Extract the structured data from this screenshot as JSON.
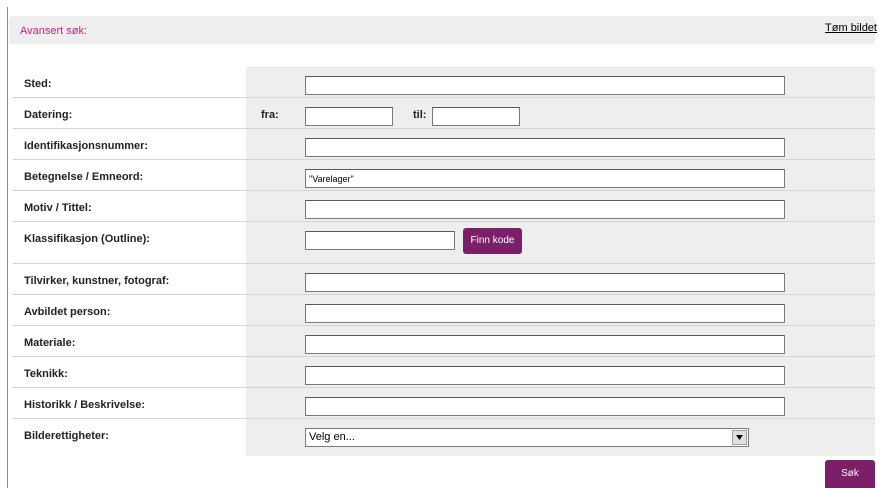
{
  "header": {
    "title": "Avansert søk:",
    "clear_link": "Tøm bildet"
  },
  "form": {
    "sted": {
      "label": "Sted:",
      "value": ""
    },
    "datering": {
      "label": "Datering:",
      "from_label": "fra:",
      "from_value": "",
      "to_label": "til:",
      "to_value": ""
    },
    "identifikasjonsnummer": {
      "label": "Identifikasjonsnummer:",
      "value": ""
    },
    "betegnelse": {
      "label": "Betegnelse / Emneord:",
      "value": "\"Varelager\""
    },
    "motiv": {
      "label": "Motiv / Tittel:",
      "value": ""
    },
    "klassifikasjon": {
      "label": "Klassifikasjon (Outline):",
      "value": "",
      "button": "Finn kode"
    },
    "tilvirker": {
      "label": "Tilvirker, kunstner, fotograf:",
      "value": ""
    },
    "avbildet": {
      "label": "Avbildet person:",
      "value": ""
    },
    "materiale": {
      "label": "Materiale:",
      "value": ""
    },
    "teknikk": {
      "label": "Teknikk:",
      "value": ""
    },
    "historikk": {
      "label": "Historikk / Beskrivelse:",
      "value": ""
    },
    "bilderettigheter": {
      "label": "Bilderettigheter:",
      "selected": "Velg en..."
    }
  },
  "actions": {
    "search_button": "Søk"
  },
  "colors": {
    "accent": "#7a1f68",
    "header_title": "#cc1f8a",
    "cell_bg": "#eeeeee"
  }
}
